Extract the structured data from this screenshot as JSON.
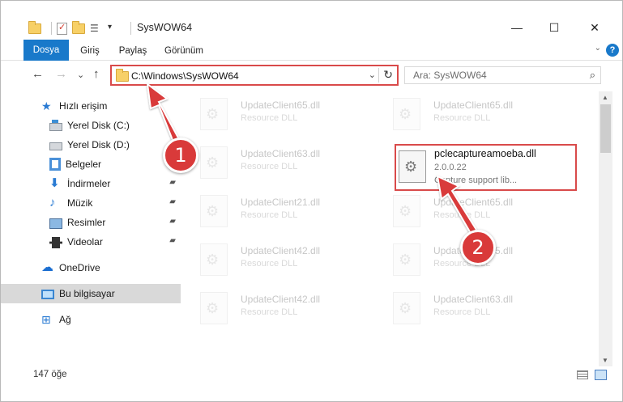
{
  "window": {
    "title": "SysWOW64",
    "minimize": "—",
    "maximize": "☐",
    "close": "✕"
  },
  "ribbon": {
    "tabs": [
      "Dosya",
      "Giriş",
      "Paylaş",
      "Görünüm"
    ],
    "help": "?",
    "collapse": "⌄"
  },
  "nav": {
    "back": "←",
    "forward": "→",
    "recent": "⌄",
    "up": "↑",
    "address": "C:\\Windows\\SysWOW64",
    "dropdown": "⌄",
    "refresh": "↻",
    "search_placeholder": "Ara: SysWOW64",
    "search_icon": "⌕"
  },
  "sidebar": {
    "items": [
      {
        "label": "Hızlı erişim",
        "icon": "star-icon"
      },
      {
        "label": "Yerel Disk (C:)",
        "icon": "drive-c-icon"
      },
      {
        "label": "Yerel Disk (D:)",
        "icon": "drive-d-icon"
      },
      {
        "label": "Belgeler",
        "icon": "documents-icon"
      },
      {
        "label": "İndirmeler",
        "icon": "downloads-icon"
      },
      {
        "label": "Müzik",
        "icon": "music-icon"
      },
      {
        "label": "Resimler",
        "icon": "pictures-icon"
      },
      {
        "label": "Videolar",
        "icon": "videos-icon"
      },
      {
        "label": "OneDrive",
        "icon": "cloud-icon"
      },
      {
        "label": "Bu bilgisayar",
        "icon": "computer-icon"
      },
      {
        "label": "Ağ",
        "icon": "network-icon"
      }
    ],
    "pin_glyph": "📌"
  },
  "files": [
    {
      "name": "UpdateClient65.dll",
      "desc": "Resource DLL"
    },
    {
      "name": "UpdateClient65.dll",
      "desc": "Resource DLL"
    },
    {
      "name": "UpdateClient63.dll",
      "desc": "Resource DLL"
    },
    {
      "name": "UpdateClient21.dll",
      "desc": "Resource DLL"
    },
    {
      "name": "UpdateClient65.dll",
      "desc": "Resource DLL"
    },
    {
      "name": "UpdateClient42.dll",
      "desc": "Resource DLL"
    },
    {
      "name": "UpdateClient65.dll",
      "desc": "Resource DLL"
    },
    {
      "name": "UpdateClient42.dll",
      "desc": "Resource DLL"
    },
    {
      "name": "UpdateClient63.dll",
      "desc": "Resource DLL"
    }
  ],
  "highlighted_file": {
    "name": "pclecaptureamoeba.dll",
    "version": "2.0.0.22",
    "desc": "Capture support lib..."
  },
  "status": {
    "count": "147 öğe"
  },
  "callouts": {
    "one": "1",
    "two": "2"
  },
  "colors": {
    "accent": "#1979ca",
    "highlight": "#d94a4a",
    "badge": "#d93a3a"
  }
}
